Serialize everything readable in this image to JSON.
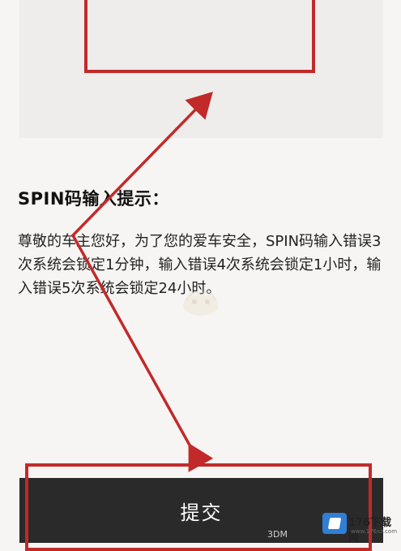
{
  "tips": {
    "title": "SPIN码输入提示：",
    "body": "尊敬的车主您好，为了您的爱车安全，SPIN码输入错误3次系统会锁定1分钟，输入错误4次系统会锁定1小时，输入错误5次系统会锁定24小时。"
  },
  "actions": {
    "submit_label": "提交"
  },
  "watermark": {
    "site_name": "176下载网",
    "site_url": "www.176xz.com",
    "mark_text": "3DM"
  },
  "colors": {
    "annotation_red": "#c22a2a",
    "button_bg": "#2b2a2a",
    "page_bg": "#f6f5f3"
  }
}
